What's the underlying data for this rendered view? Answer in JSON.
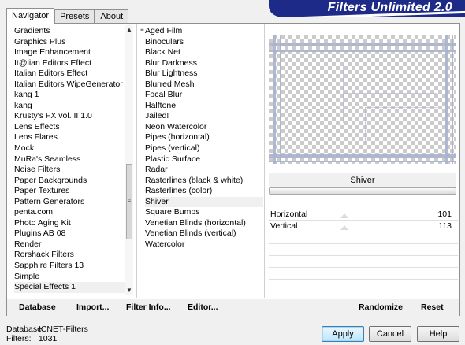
{
  "window": {
    "title": "Filters Unlimited 2.0"
  },
  "tabs": [
    {
      "label": "Navigator",
      "active": true
    },
    {
      "label": "Presets",
      "active": false
    },
    {
      "label": "About",
      "active": false
    }
  ],
  "categories": {
    "items": [
      "Gradients",
      "Graphics Plus",
      "Image Enhancement",
      "It@lian Editors Effect",
      "Italian Editors Effect",
      "Italian Editors WipeGenerator",
      "kang 1",
      "kang",
      "Krusty's FX vol. II 1.0",
      "Lens Effects",
      "Lens Flares",
      "Mock",
      "MuRa's Seamless",
      "Noise Filters",
      "Paper Backgrounds",
      "Paper Textures",
      "Pattern Generators",
      "penta.com",
      "Photo Aging Kit",
      "Plugins AB 08",
      "Render",
      "Rorshack Filters",
      "Sapphire Filters 13",
      "Simple",
      "Special Effects 1"
    ],
    "selected": "Special Effects 1"
  },
  "filters": {
    "items": [
      "Aged Film",
      "Binoculars",
      "Black Net",
      "Blur Darkness",
      "Blur Lightness",
      "Blurred Mesh",
      "Focal Blur",
      "Halftone",
      "Jailed!",
      "Neon Watercolor",
      "Pipes (horizontal)",
      "Pipes (vertical)",
      "Plastic Surface",
      "Radar",
      "Rasterlines (black & white)",
      "Rasterlines (color)",
      "Shiver",
      "Square Bumps",
      "Venetian Blinds (horizontal)",
      "Venetian Blinds (vertical)",
      "Watercolor"
    ],
    "selected": "Shiver"
  },
  "preview": {
    "filter_name": "Shiver",
    "progress": 0.0
  },
  "parameters": [
    {
      "label": "Horizontal",
      "value": "101"
    },
    {
      "label": "Vertical",
      "value": "113"
    }
  ],
  "toolbar": {
    "database": "Database",
    "import": "Import...",
    "filter_info": "Filter Info...",
    "editor": "Editor...",
    "randomize": "Randomize",
    "reset": "Reset"
  },
  "status": {
    "database_label": "Database:",
    "database_value": "ICNET-Filters",
    "filters_label": "Filters:",
    "filters_value": "1031"
  },
  "buttons": {
    "apply": "Apply",
    "cancel": "Cancel",
    "help": "Help"
  },
  "colors": {
    "banner": "#1e2a88",
    "preview_lines": "#aab3cd"
  },
  "icons": {
    "scroll_up": "triangle-up",
    "scroll_down": "triangle-down",
    "filter_marker": "grip"
  }
}
